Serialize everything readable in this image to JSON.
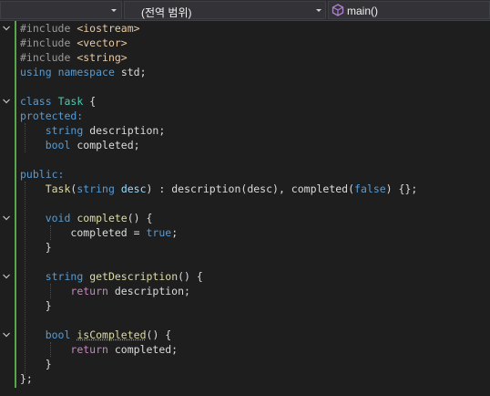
{
  "navbar": {
    "project": "",
    "scope": "(전역 범위)",
    "member": "main()"
  },
  "code": {
    "l1": [
      "#include",
      "<iostream>"
    ],
    "l2": [
      "#include",
      "<vector>"
    ],
    "l3": [
      "#include",
      "<string>"
    ],
    "l4": [
      "using",
      "namespace",
      "std;"
    ],
    "l6": [
      "class",
      "Task",
      "{"
    ],
    "l7": [
      "protected:"
    ],
    "l8": [
      "string",
      "description;"
    ],
    "l9": [
      "bool",
      "completed;"
    ],
    "l11": [
      "public:"
    ],
    "l12": [
      "Task",
      "(",
      "string",
      "desc",
      ") : ",
      "description",
      "(desc), ",
      "completed",
      "(",
      "false",
      ") {};"
    ],
    "l14": [
      "void",
      "complete",
      "() {"
    ],
    "l15": [
      "completed",
      " = ",
      "true",
      ";"
    ],
    "l16": [
      "}"
    ],
    "l18": [
      "string",
      "getDescription",
      "() {"
    ],
    "l19": [
      "return",
      "description;"
    ],
    "l20": [
      "}"
    ],
    "l22": [
      "bool",
      "isCompleted",
      "() {"
    ],
    "l23": [
      "return",
      "completed;"
    ],
    "l24": [
      "}"
    ],
    "l25": [
      "};"
    ]
  }
}
